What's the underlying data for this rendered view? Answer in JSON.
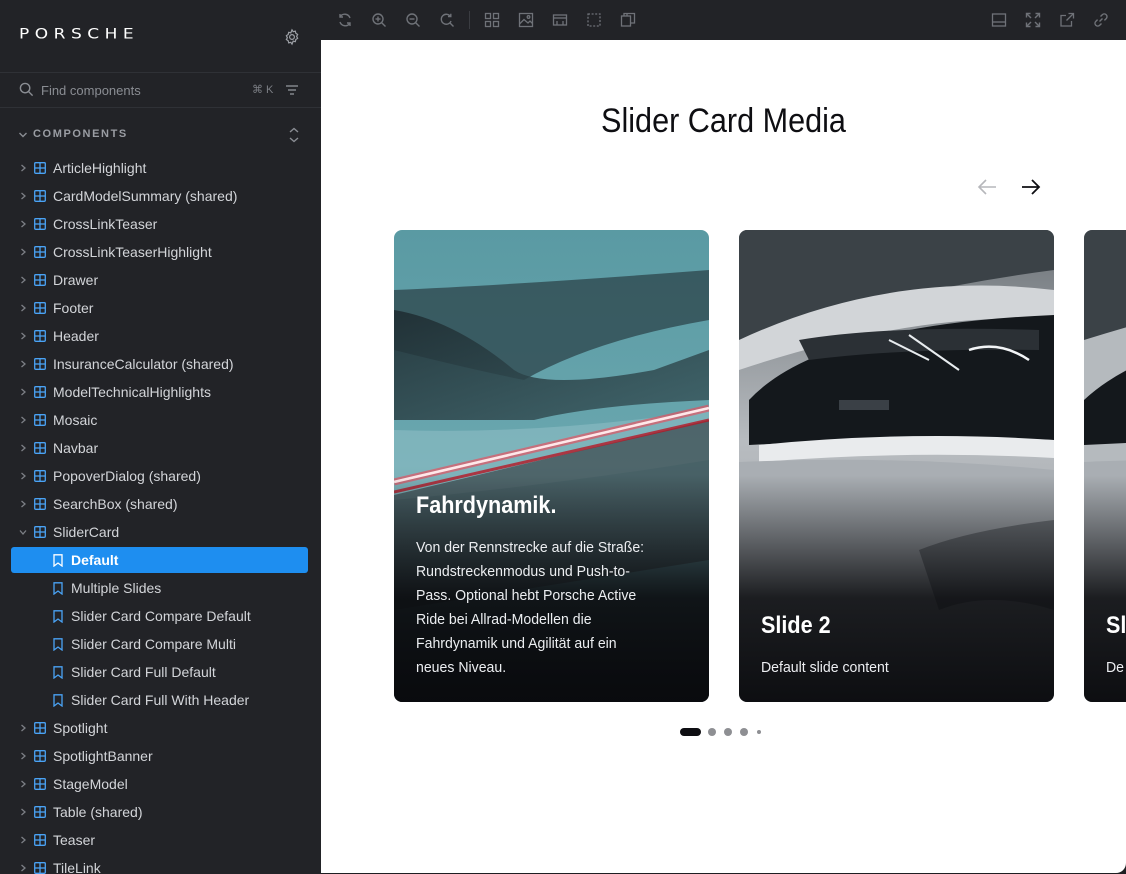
{
  "sidebar": {
    "logo": "PORSCHE",
    "search": {
      "placeholder": "Find components",
      "shortcut": "⌘ K"
    },
    "section_label": "COMPONENTS",
    "items": [
      {
        "label": "ArticleHighlight",
        "kind": "component"
      },
      {
        "label": "CardModelSummary (shared)",
        "kind": "component"
      },
      {
        "label": "CrossLinkTeaser",
        "kind": "component"
      },
      {
        "label": "CrossLinkTeaserHighlight",
        "kind": "component"
      },
      {
        "label": "Drawer",
        "kind": "component"
      },
      {
        "label": "Footer",
        "kind": "component"
      },
      {
        "label": "Header",
        "kind": "component"
      },
      {
        "label": "InsuranceCalculator (shared)",
        "kind": "component"
      },
      {
        "label": "ModelTechnicalHighlights",
        "kind": "component"
      },
      {
        "label": "Mosaic",
        "kind": "component"
      },
      {
        "label": "Navbar",
        "kind": "component"
      },
      {
        "label": "PopoverDialog (shared)",
        "kind": "component"
      },
      {
        "label": "SearchBox (shared)",
        "kind": "component"
      },
      {
        "label": "SliderCard",
        "kind": "component",
        "expanded": true
      },
      {
        "label": "Default",
        "kind": "story",
        "selected": true
      },
      {
        "label": "Multiple Slides",
        "kind": "story"
      },
      {
        "label": "Slider Card Compare Default",
        "kind": "story"
      },
      {
        "label": "Slider Card Compare Multi",
        "kind": "story"
      },
      {
        "label": "Slider Card Full Default",
        "kind": "story"
      },
      {
        "label": "Slider Card Full With Header",
        "kind": "story"
      },
      {
        "label": "Spotlight",
        "kind": "component"
      },
      {
        "label": "SpotlightBanner",
        "kind": "component"
      },
      {
        "label": "StageModel",
        "kind": "component"
      },
      {
        "label": "Table (shared)",
        "kind": "component"
      },
      {
        "label": "Teaser",
        "kind": "component"
      },
      {
        "label": "TileLink",
        "kind": "component"
      }
    ]
  },
  "toolbar": {
    "icons": [
      "reload-icon",
      "zoom-in-icon",
      "zoom-out-icon",
      "zoom-reset-icon",
      "grid-icon",
      "background-icon",
      "viewport-icon",
      "outline-icon",
      "measure-icon",
      "panel-toggle-icon",
      "fullscreen-icon",
      "open-new-tab-icon",
      "copy-link-icon"
    ]
  },
  "preview": {
    "title": "Slider Card Media",
    "cards": [
      {
        "title": "Fahrdynamik.",
        "body": "Von der Rennstrecke auf die Straße: Rundstreckenmodus und Push-to-Pass. Optional hebt Porsche Active Ride bei Allrad-Modellen die Fahrdynamik und Agilität auf ein neues Niveau."
      },
      {
        "title": "Slide 2",
        "body": "Default slide content"
      },
      {
        "title": "Sl",
        "body": "De"
      }
    ],
    "pagination": {
      "total_dots": 5,
      "active_index": 0
    }
  },
  "colors": {
    "accent": "#1e8ef0",
    "sidebar_bg": "#222327",
    "icon_blue": "#4aa3f5"
  }
}
